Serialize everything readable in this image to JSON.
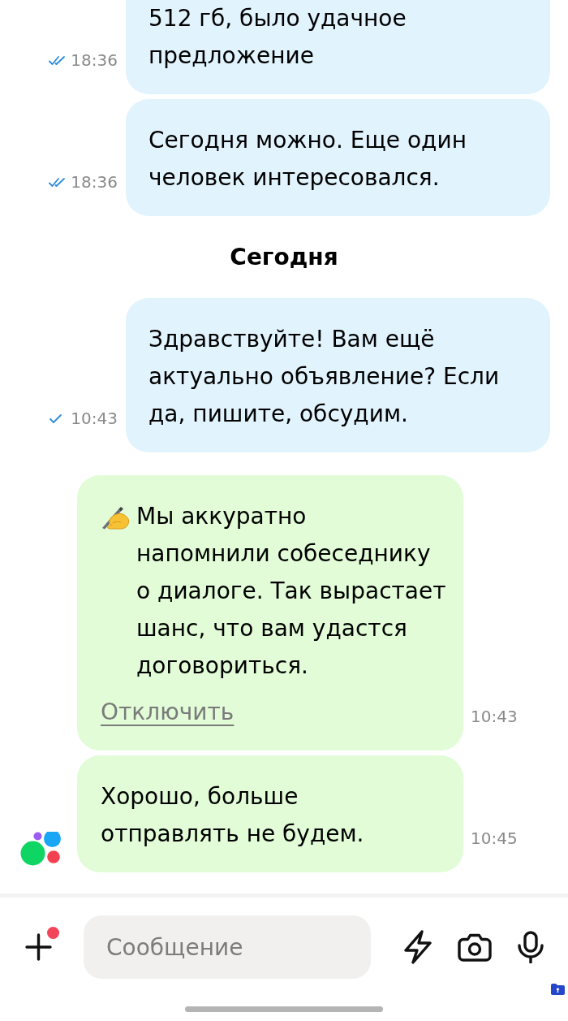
{
  "messages": [
    {
      "kind": "outgoing",
      "text": "512 гб, было удачное предложение",
      "time": "18:36",
      "read": true
    },
    {
      "kind": "outgoing",
      "text": "Сегодня можно. Еще один человек интересовался.",
      "time": "18:36",
      "read": true
    },
    {
      "kind": "date",
      "text": "Сегодня"
    },
    {
      "kind": "outgoing",
      "text": "Здравствуйте! Вам ещё актуально объявление? Если да, пишите, обсудим.",
      "time": "10:43",
      "read": false
    },
    {
      "kind": "notice",
      "text": "Мы аккуратно\nнапомнили собеседнику\nо диалоге. Так вырастает\nшанс, что вам удастся\nдоговориться.",
      "link": "Отключить",
      "time": "10:43"
    },
    {
      "kind": "incoming",
      "text": "Хорошо, больше отправлять не будем.",
      "time": "10:45",
      "avatar": true
    }
  ],
  "composer": {
    "placeholder": "Сообщение",
    "attach_badge": true
  }
}
